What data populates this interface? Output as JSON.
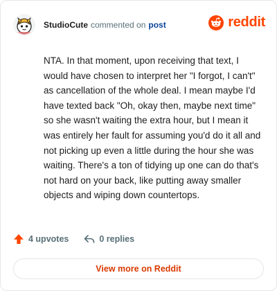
{
  "header": {
    "username": "StudioCute",
    "action_text": "commented on",
    "post_link": "post",
    "brand_word": "reddit"
  },
  "comment": {
    "text": "NTA. In that moment, upon receiving that text, I would have chosen to interpret her \"I forgot, I can't\" as cancellation of the whole deal. I mean maybe I'd have texted back \"Oh, okay then, maybe next time\" so she wasn't waiting the extra hour, but I mean it was entirely her fault for assuming you'd do it all and not picking up even a little during the hour she was waiting. There's a ton of tidying up one can do that's not hard on your back, like putting away smaller objects and wiping down countertops."
  },
  "actions": {
    "upvotes": "4 upvotes",
    "replies": "0 replies"
  },
  "footer": {
    "view_more": "View more on Reddit"
  },
  "colors": {
    "brand": "#ff4500",
    "link": "#0a449b",
    "cta": "#d93a00"
  }
}
